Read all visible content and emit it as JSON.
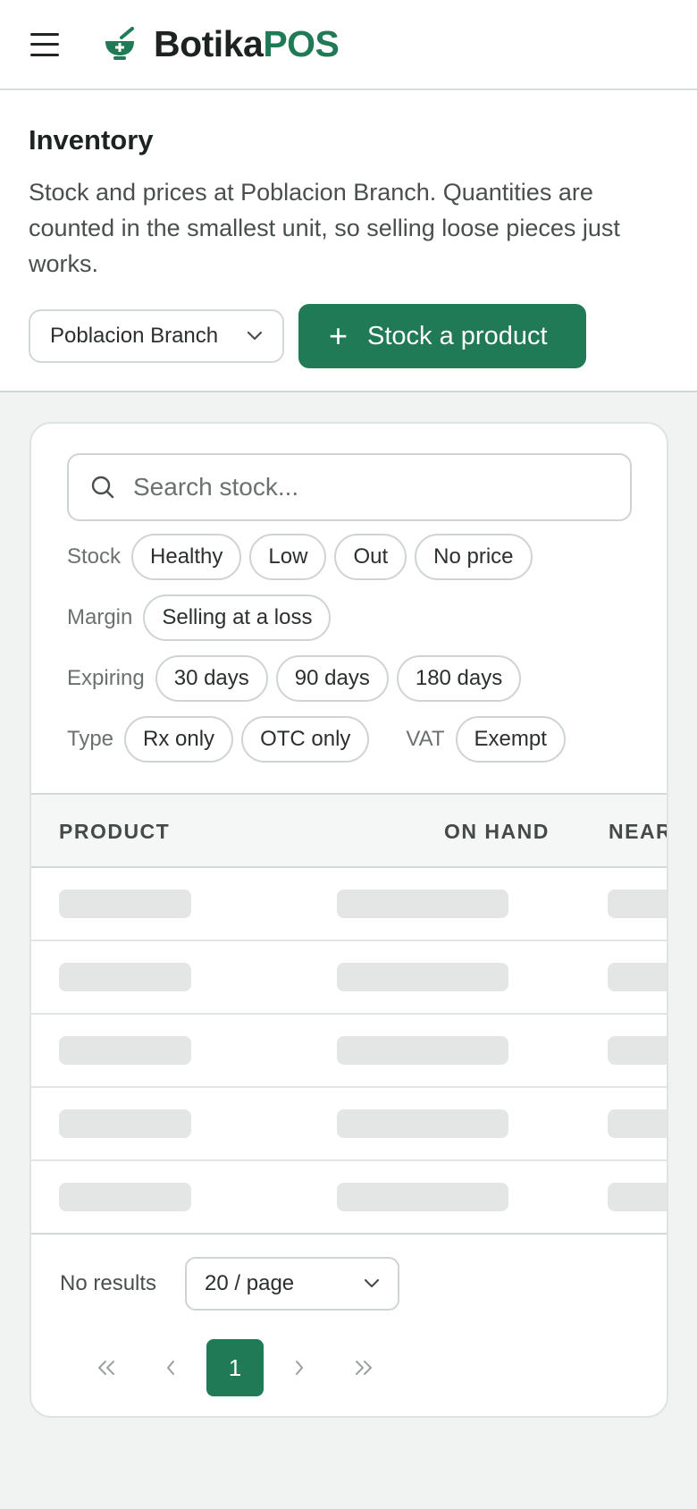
{
  "app": {
    "brand_part1": "Botika",
    "brand_part2": "POS"
  },
  "header": {
    "menu_icon": "hamburger-icon",
    "logo_icon": "mortar-pestle-icon"
  },
  "page": {
    "title": "Inventory",
    "description": "Stock and prices at Poblacion Branch. Quantities are counted in the smallest unit, so selling loose pieces just works."
  },
  "actions": {
    "branch": "Poblacion Branch",
    "stock_button": "Stock a product",
    "stock_button_icon": "plus-icon"
  },
  "search": {
    "placeholder": "Search stock..."
  },
  "filters": {
    "stock_label": "Stock",
    "stock_chips": [
      "Healthy",
      "Low",
      "Out",
      "No price"
    ],
    "margin_label": "Margin",
    "margin_chips": [
      "Selling at a loss"
    ],
    "expiring_label": "Expiring",
    "expiring_chips": [
      "30 days",
      "90 days",
      "180 days"
    ],
    "type_label": "Type",
    "type_chips": [
      "Rx only",
      "OTC only"
    ],
    "vat_label": "VAT",
    "vat_chips": [
      "Exempt"
    ]
  },
  "table": {
    "columns": [
      "PRODUCT",
      "ON HAND",
      "NEAR"
    ],
    "loading_rows": 5
  },
  "footer": {
    "status": "No results",
    "page_size": "20 / page",
    "current_page": "1"
  },
  "colors": {
    "accent": "#1f7a55",
    "skeleton": "#e3e6e5"
  }
}
